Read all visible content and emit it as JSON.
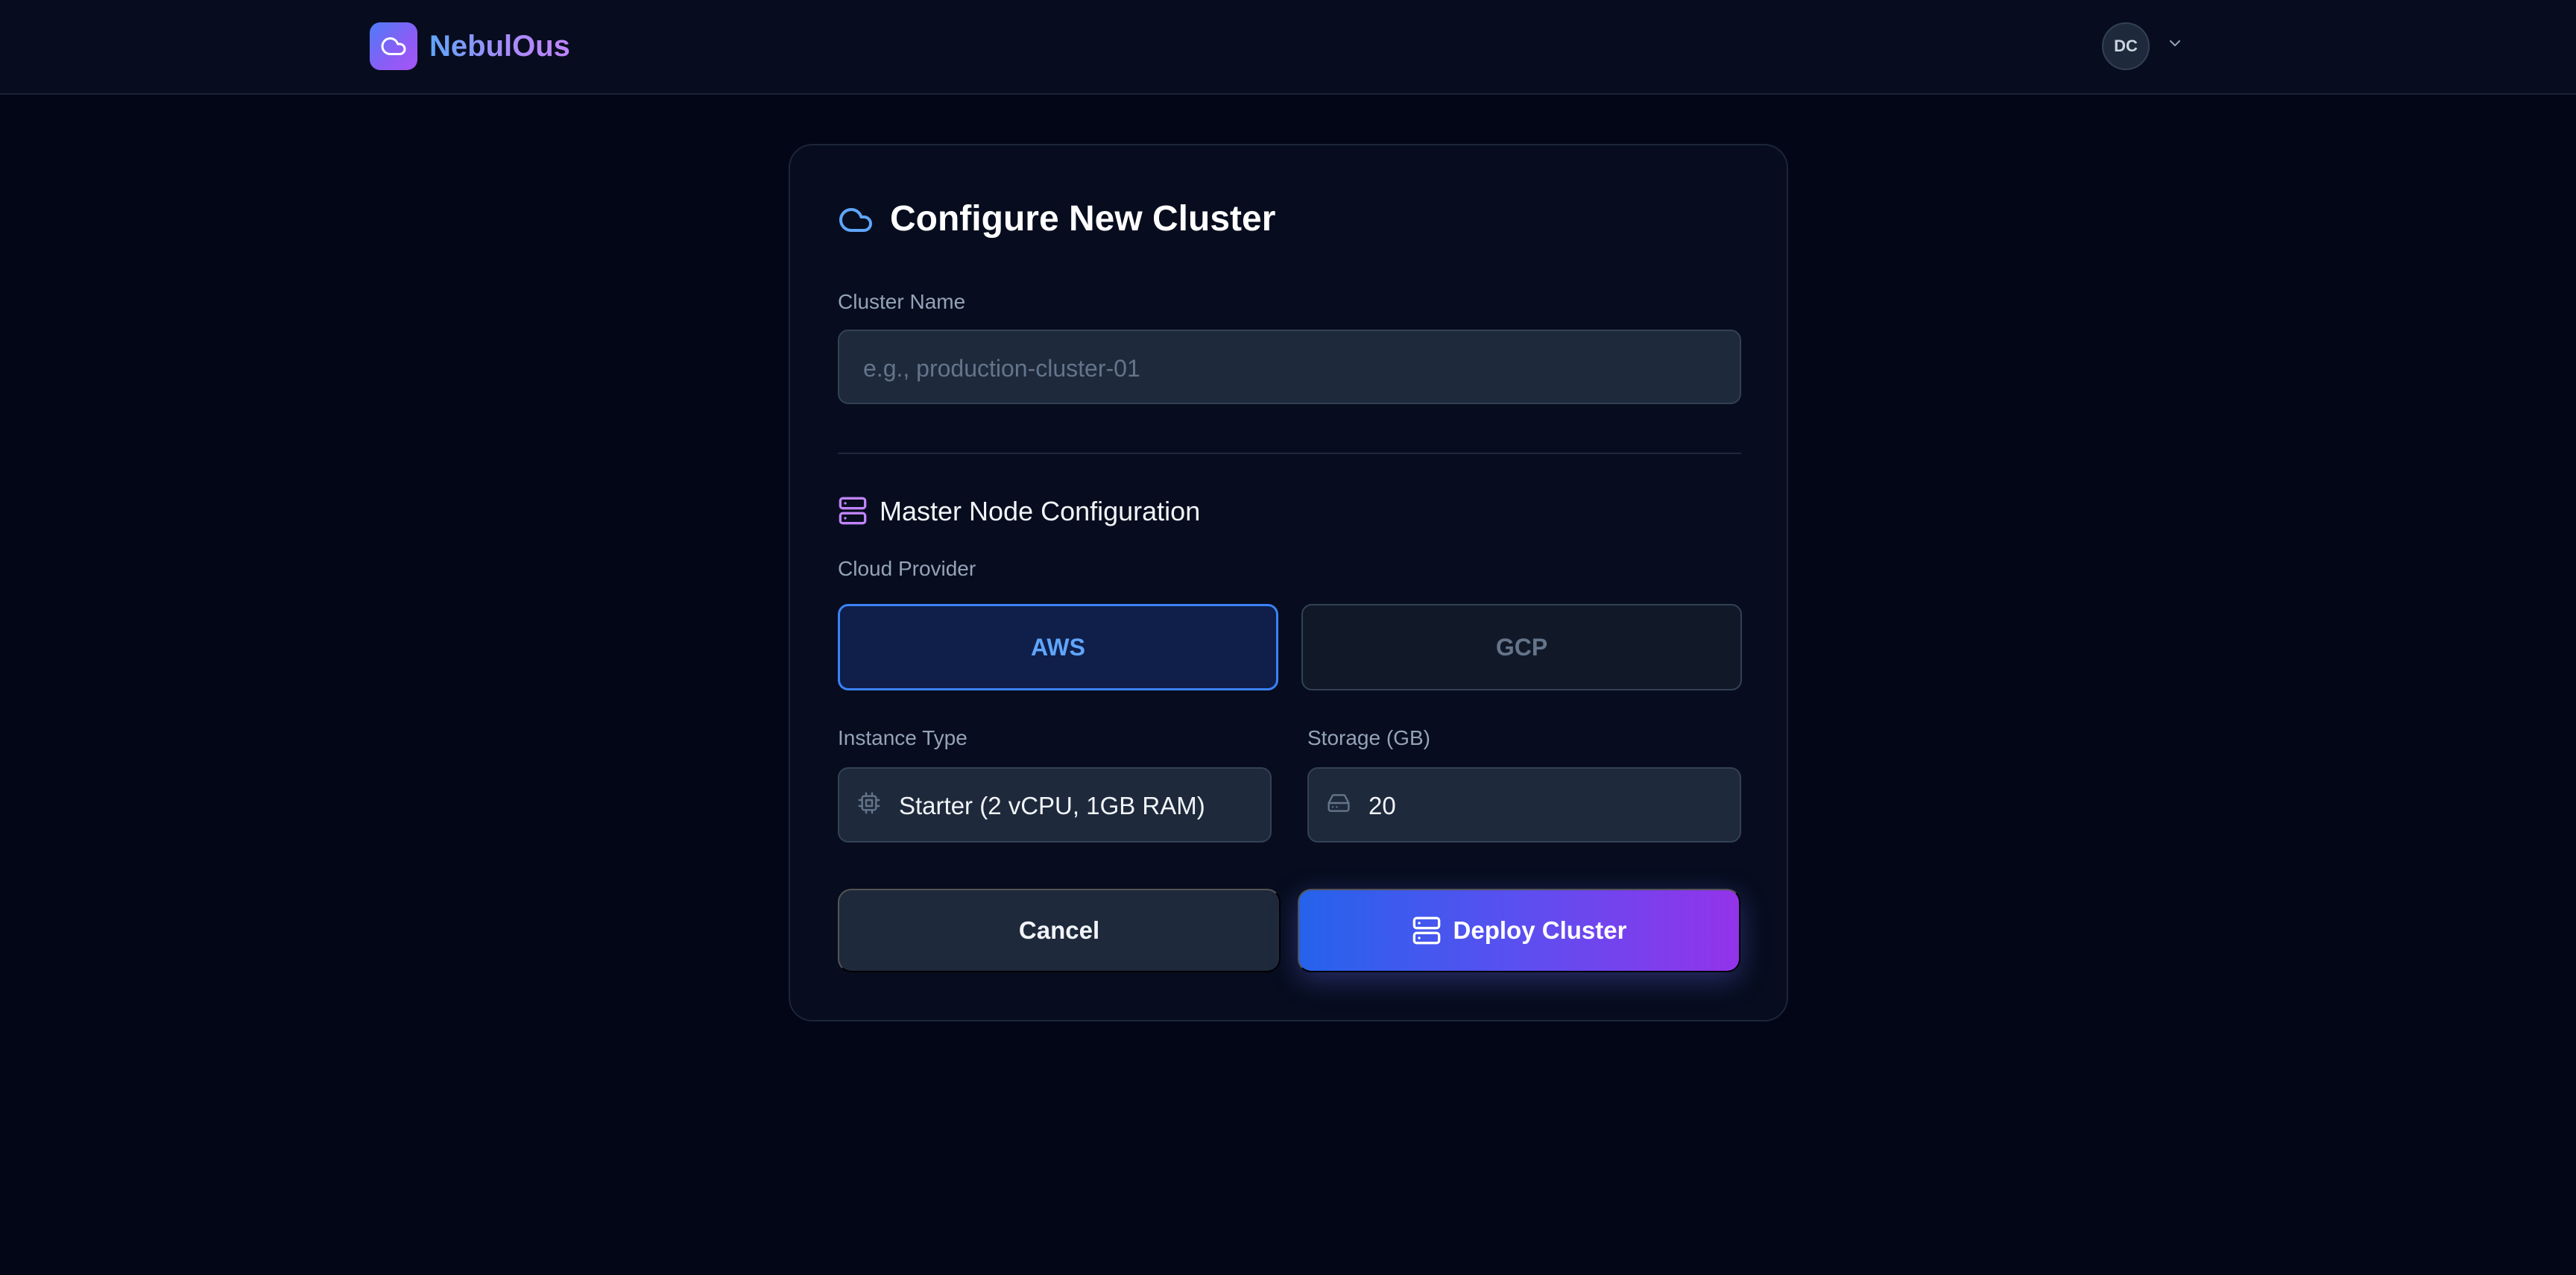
{
  "header": {
    "brand": "NebulOus",
    "user_initials": "DC"
  },
  "form": {
    "title": "Configure New Cluster",
    "cluster_name": {
      "label": "Cluster Name",
      "placeholder": "e.g., production-cluster-01",
      "value": ""
    },
    "master_section": {
      "title": "Master Node Configuration",
      "provider_label": "Cloud Provider",
      "providers": [
        {
          "label": "AWS",
          "selected": true
        },
        {
          "label": "GCP",
          "selected": false
        }
      ],
      "instance_type": {
        "label": "Instance Type",
        "value": "Starter (2 vCPU, 1GB RAM)"
      },
      "storage": {
        "label": "Storage (GB)",
        "value": "20"
      }
    },
    "actions": {
      "cancel": "Cancel",
      "deploy": "Deploy Cluster"
    }
  },
  "colors": {
    "background": "#020617",
    "accent_blue": "#3b82f6",
    "accent_purple": "#9333ea"
  },
  "icons": {
    "logo": "cloud-icon",
    "title": "cloud-icon",
    "section": "server-icon",
    "instance": "cpu-icon",
    "storage": "hard-drive-icon",
    "deploy": "server-icon",
    "user_menu": "chevron-down-icon"
  }
}
